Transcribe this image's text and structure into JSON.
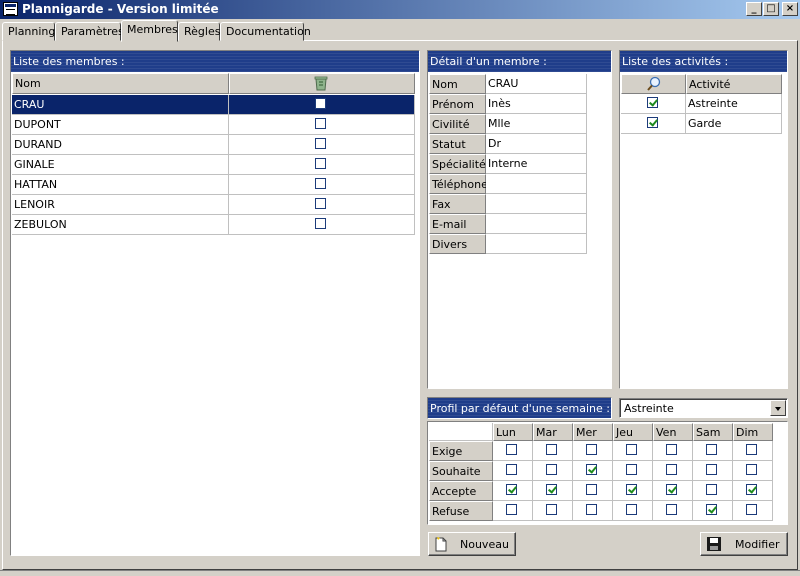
{
  "window": {
    "title": "Plannigarde - Version limitée",
    "minimize": "_",
    "maximize": "□",
    "close": "×"
  },
  "tabs": [
    {
      "label": "Planning"
    },
    {
      "label": "Paramètres"
    },
    {
      "label": "Membres",
      "active": true
    },
    {
      "label": "Règles"
    },
    {
      "label": "Documentation"
    }
  ],
  "members_panel": {
    "header": "Liste des membres :",
    "col_name": "Nom",
    "col_delete_icon": "trash-icon",
    "rows": [
      {
        "name": "CRAU",
        "checked": false,
        "selected": true
      },
      {
        "name": "DUPONT",
        "checked": false
      },
      {
        "name": "DURAND",
        "checked": false
      },
      {
        "name": "GINALE",
        "checked": false
      },
      {
        "name": "HATTAN",
        "checked": false
      },
      {
        "name": "LENOIR",
        "checked": false
      },
      {
        "name": "ZEBULON",
        "checked": false
      }
    ]
  },
  "detail_panel": {
    "header": "Détail d'un membre :",
    "fields": [
      {
        "label": "Nom",
        "value": "CRAU"
      },
      {
        "label": "Prénom",
        "value": "Inès"
      },
      {
        "label": "Civilité",
        "value": "Mlle"
      },
      {
        "label": "Statut",
        "value": "Dr"
      },
      {
        "label": "Spécialité",
        "value": "Interne"
      },
      {
        "label": "Téléphone",
        "value": ""
      },
      {
        "label": "Fax",
        "value": ""
      },
      {
        "label": "E-mail",
        "value": ""
      },
      {
        "label": "Divers",
        "value": ""
      }
    ]
  },
  "activities_panel": {
    "header": "Liste des activités :",
    "col_icon": "search-icon",
    "col_activity": "Activité",
    "rows": [
      {
        "label": "Astreinte",
        "checked": true
      },
      {
        "label": "Garde",
        "checked": true
      }
    ]
  },
  "profile_panel": {
    "header": "Profil par défaut d'une semaine :",
    "activity_select": "Astreinte",
    "days": [
      "Lun",
      "Mar",
      "Mer",
      "Jeu",
      "Ven",
      "Sam",
      "Dim"
    ],
    "rows": [
      {
        "label": "Exige",
        "values": [
          false,
          false,
          false,
          false,
          false,
          false,
          false
        ]
      },
      {
        "label": "Souhaite",
        "values": [
          false,
          false,
          true,
          false,
          false,
          false,
          false
        ]
      },
      {
        "label": "Accepte",
        "values": [
          true,
          true,
          false,
          true,
          true,
          false,
          true
        ]
      },
      {
        "label": "Refuse",
        "values": [
          false,
          false,
          false,
          false,
          false,
          true,
          false
        ]
      }
    ]
  },
  "buttons": {
    "new_label": "Nouveau",
    "modify_label": "Modifier"
  }
}
